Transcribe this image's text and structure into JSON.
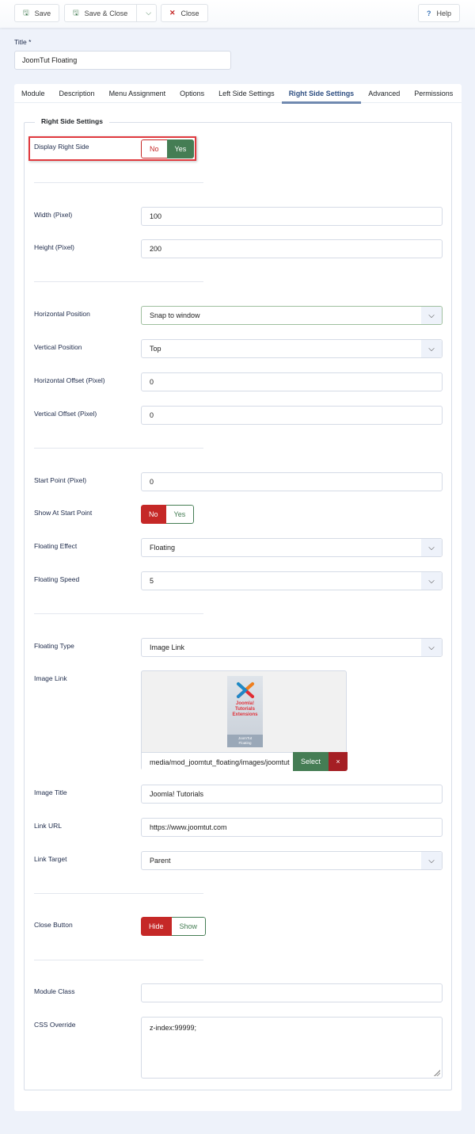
{
  "toolbar": {
    "save_label": "Save",
    "save_close_label": "Save & Close",
    "close_label": "Close",
    "help_label": "Help"
  },
  "title_field": {
    "label": "Title *",
    "value": "JoomTut Floating"
  },
  "tabs": [
    {
      "label": "Module",
      "active": false
    },
    {
      "label": "Description",
      "active": false
    },
    {
      "label": "Menu Assignment",
      "active": false
    },
    {
      "label": "Options",
      "active": false
    },
    {
      "label": "Left Side Settings",
      "active": false
    },
    {
      "label": "Right Side Settings",
      "active": true
    },
    {
      "label": "Advanced",
      "active": false
    },
    {
      "label": "Permissions",
      "active": false
    }
  ],
  "fieldset_legend": "Right Side Settings",
  "fields": {
    "display_right_side": {
      "label": "Display Right Side",
      "options": [
        "No",
        "Yes"
      ],
      "selected": "Yes"
    },
    "width": {
      "label": "Width (Pixel)",
      "value": "100"
    },
    "height": {
      "label": "Height (Pixel)",
      "value": "200"
    },
    "horizontal_position": {
      "label": "Horizontal Position",
      "value": "Snap to window"
    },
    "vertical_position": {
      "label": "Vertical Position",
      "value": "Top"
    },
    "horizontal_offset": {
      "label": "Horizontal Offset (Pixel)",
      "value": "0"
    },
    "vertical_offset": {
      "label": "Vertical Offset (Pixel)",
      "value": "0"
    },
    "start_point": {
      "label": "Start Point (Pixel)",
      "value": "0"
    },
    "show_at_start_point": {
      "label": "Show At Start Point",
      "options": [
        "No",
        "Yes"
      ],
      "selected": "No"
    },
    "floating_effect": {
      "label": "Floating Effect",
      "value": "Floating"
    },
    "floating_speed": {
      "label": "Floating Speed",
      "value": "5"
    },
    "floating_type": {
      "label": "Floating Type",
      "value": "Image Link"
    },
    "image_link": {
      "label": "Image Link",
      "path": "media/mod_joomtut_floating/images/joomtut",
      "select_label": "Select",
      "clear_label": "×",
      "thumb_text": [
        "Joomla!",
        "Tutorials",
        "Extensions"
      ],
      "thumb_footer": [
        "JoomTut",
        "Floating"
      ]
    },
    "image_title": {
      "label": "Image Title",
      "value": "Joomla! Tutorials"
    },
    "link_url": {
      "label": "Link URL",
      "value": "https://www.joomtut.com"
    },
    "link_target": {
      "label": "Link Target",
      "value": "Parent"
    },
    "close_button": {
      "label": "Close Button",
      "options": [
        "Hide",
        "Show"
      ],
      "selected": "Hide"
    },
    "module_class": {
      "label": "Module Class",
      "value": ""
    },
    "css_override": {
      "label": "CSS Override",
      "value": "z-index:99999;"
    }
  },
  "colors": {
    "success": "#457d54",
    "danger": "#c52827",
    "active_tab": "#2f4f82",
    "highlight_box": "#e0393e"
  }
}
